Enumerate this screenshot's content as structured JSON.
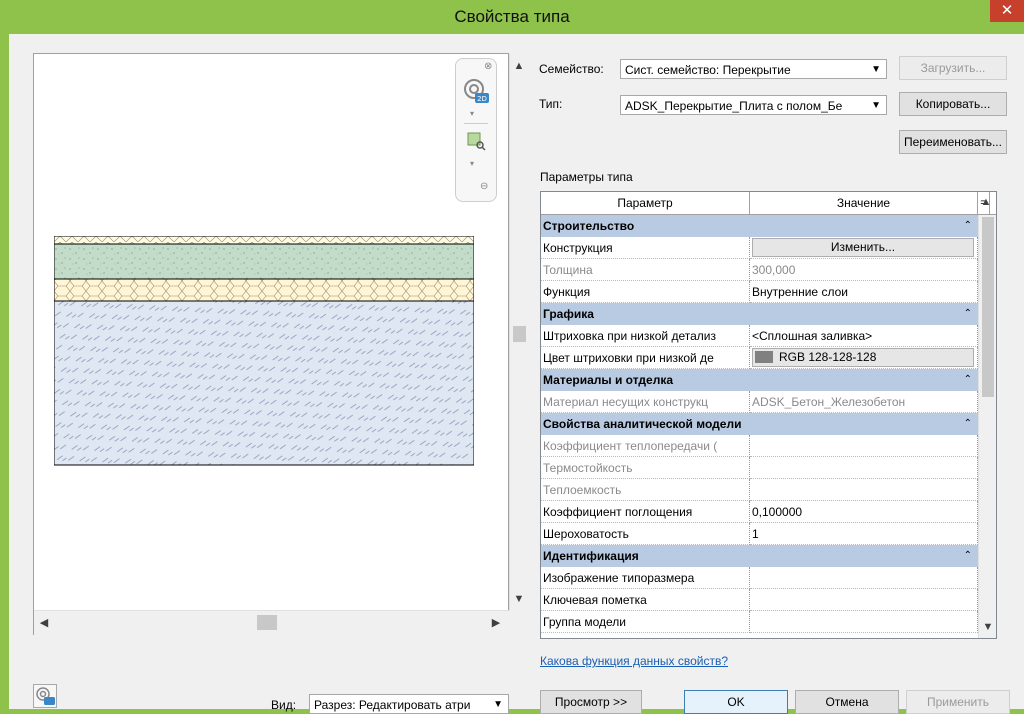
{
  "window": {
    "title": "Свойства типа",
    "close": "✕"
  },
  "family": {
    "label": "Семейство:",
    "value": "Сист. семейство: Перекрытие",
    "load_button": "Загрузить..."
  },
  "type": {
    "label": "Тип:",
    "value": "ADSK_Перекрытие_Плита с полом_Бе",
    "copy_button": "Копировать...",
    "rename_button": "Переименовать..."
  },
  "params_label": "Параметры типа",
  "table": {
    "col_param": "Параметр",
    "col_value": "Значение",
    "col_eq": "=",
    "groups": {
      "construction": "Строительство",
      "graphics": "Графика",
      "materials": "Материалы и отделка",
      "analytical": "Свойства аналитической модели",
      "identity": "Идентификация"
    },
    "rows": {
      "structure": {
        "name": "Конструкция",
        "value": "Изменить..."
      },
      "thickness": {
        "name": "Толщина",
        "value": "300,000"
      },
      "function": {
        "name": "Функция",
        "value": "Внутренние слои"
      },
      "coarse_fill": {
        "name": "Штриховка при низкой детализ",
        "value": "<Сплошная заливка>"
      },
      "coarse_color": {
        "name": "Цвет штриховки при низкой де",
        "value": "RGB 128-128-128",
        "swatch": "#808080"
      },
      "struct_material": {
        "name": "Материал несущих конструкц",
        "value": "ADSK_Бетон_Железобетон"
      },
      "heat_coef": {
        "name": "Коэффициент теплопередачи (",
        "value": ""
      },
      "thermal_res": {
        "name": "Термостойкость",
        "value": ""
      },
      "thermal_mass": {
        "name": "Теплоемкость",
        "value": ""
      },
      "absorptance": {
        "name": "Коэффициент поглощения",
        "value": "0,100000"
      },
      "roughness": {
        "name": "Шероховатость",
        "value": "1"
      },
      "type_image": {
        "name": "Изображение типоразмера",
        "value": ""
      },
      "keynote": {
        "name": "Ключевая пометка",
        "value": ""
      },
      "model_group": {
        "name": "Группа модели",
        "value": ""
      }
    }
  },
  "help_link": "Какова функция данных свойств?",
  "view": {
    "label": "Вид:",
    "value": "Разрез: Редактировать атри"
  },
  "footer": {
    "preview": "Просмотр >>",
    "ok": "OK",
    "cancel": "Отмена",
    "apply": "Применить"
  },
  "colors": {
    "titlebar": "#8ec24a",
    "category_row": "#b9cbe2",
    "close": "#c7402c"
  }
}
